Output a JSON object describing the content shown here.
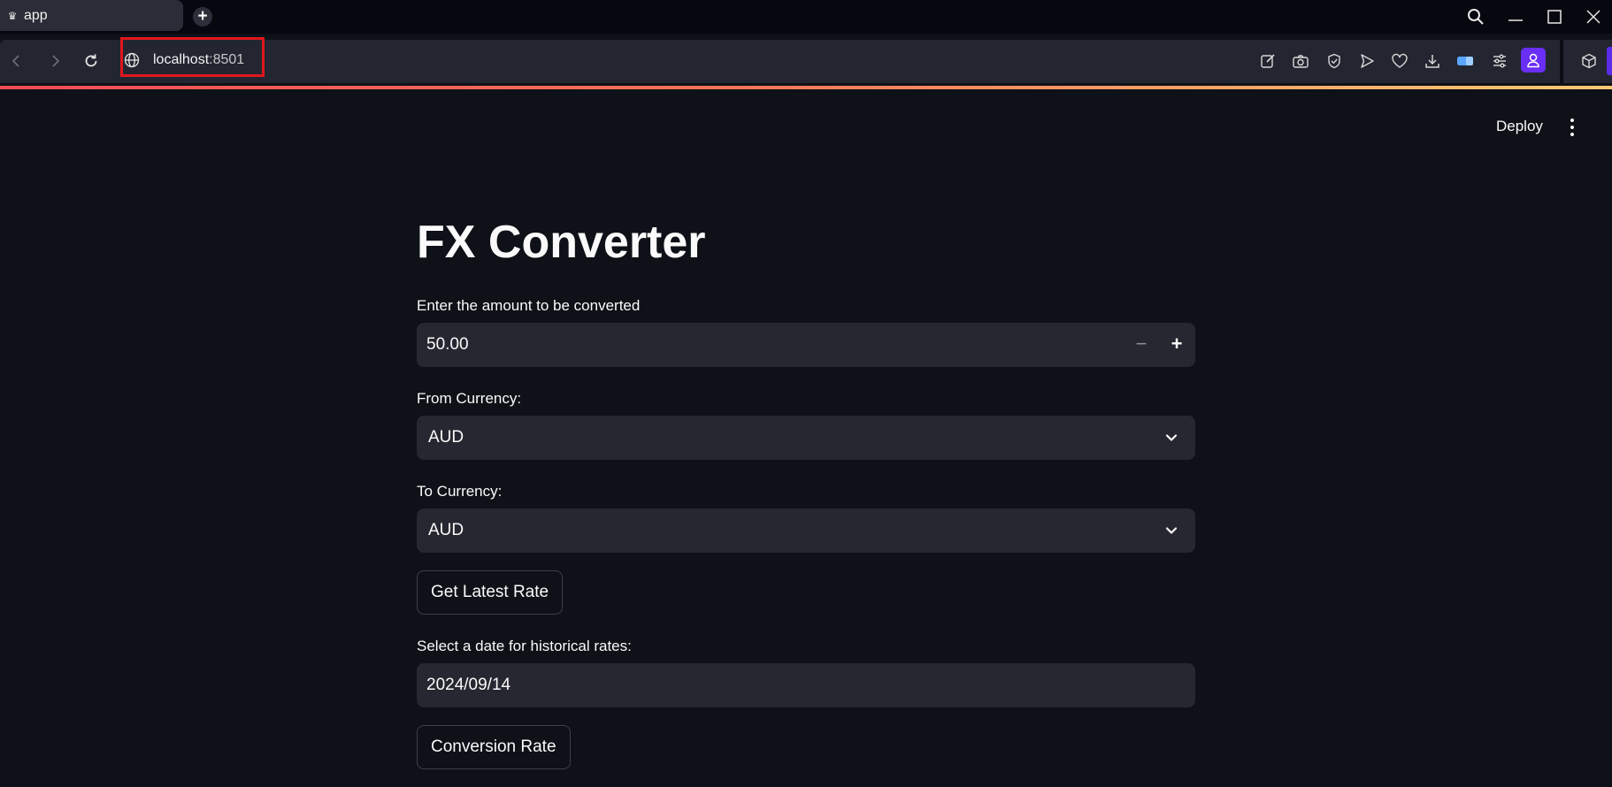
{
  "browser": {
    "tab_title": "app",
    "url_host": "localhost",
    "url_port": ":8501",
    "icons": [
      "back-icon",
      "forward-icon",
      "reload-icon",
      "globe-icon",
      "edit-icon",
      "camera-icon",
      "shield-icon",
      "send-icon",
      "heart-icon",
      "download-icon",
      "battery-icon",
      "sliders-icon",
      "profile-icon",
      "cube-icon"
    ]
  },
  "app_header": {
    "deploy_label": "Deploy"
  },
  "main": {
    "title": "FX Converter",
    "amount": {
      "label": "Enter the amount to be converted",
      "value": "50.00",
      "decrement": "−",
      "increment": "+"
    },
    "from_currency": {
      "label": "From Currency:",
      "value": "AUD"
    },
    "to_currency": {
      "label": "To Currency:",
      "value": "AUD"
    },
    "latest_button": "Get Latest Rate",
    "date": {
      "label": "Select a date for historical rates:",
      "value": "2024/09/14"
    },
    "conversion_button": "Conversion Rate"
  },
  "colors": {
    "background": "#0e1117",
    "input_bg": "#262730",
    "highlight_box": "#e0171d",
    "accent_gradient_start": "#f04b55",
    "accent_gradient_end": "#f9c974"
  }
}
